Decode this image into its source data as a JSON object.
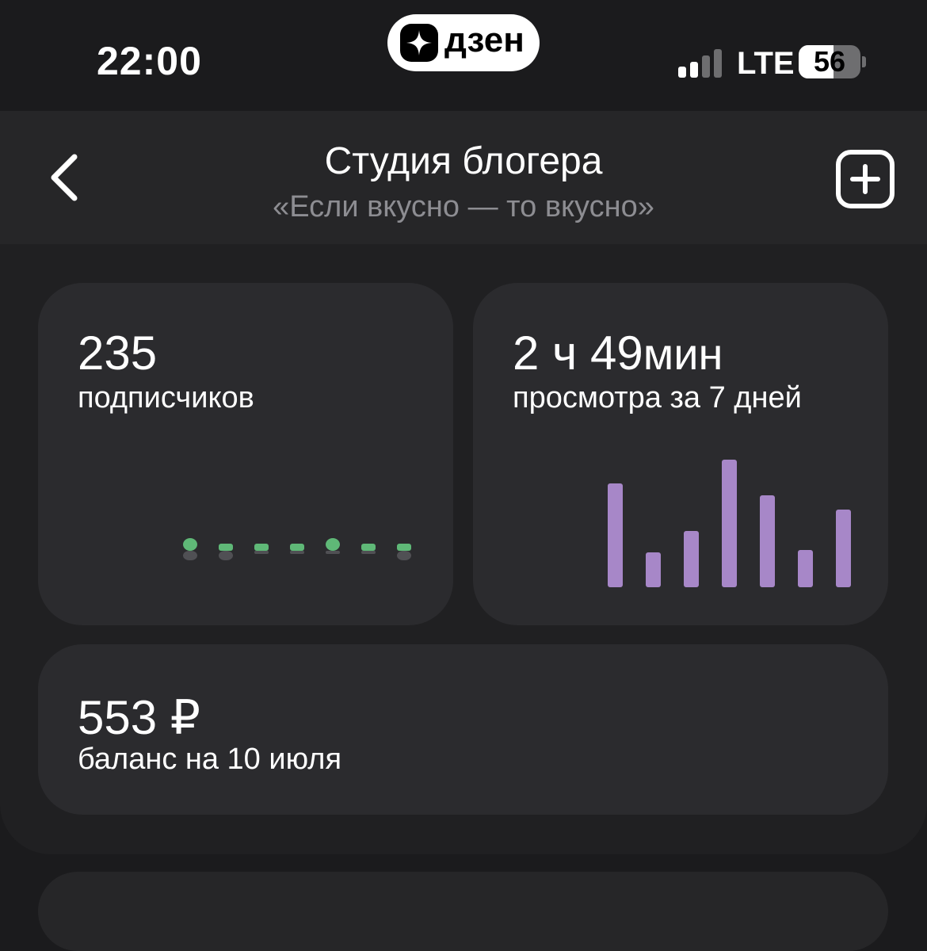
{
  "status_bar": {
    "time": "22:00",
    "app_badge": "дзен",
    "network": "LTE",
    "battery": "56",
    "battery_level": 0.56
  },
  "header": {
    "title": "Студия блогера",
    "subtitle": "«Если вкусно — то вкусно»"
  },
  "cards": {
    "subscribers": {
      "value": "235",
      "label": "подписчиков",
      "bars": [
        {
          "up": 1,
          "down": 1
        },
        {
          "up": 0.6,
          "down": 1
        },
        {
          "up": 0.6,
          "down": 0
        },
        {
          "up": 0.6,
          "down": 0
        },
        {
          "up": 1,
          "down": 0.3
        },
        {
          "up": 0.6,
          "down": 0
        },
        {
          "up": 0.6,
          "down": 1
        }
      ],
      "up_color": "#5fb877",
      "down_color": "#505054"
    },
    "views": {
      "value_hours": "2 ч",
      "value_minutes": "49",
      "value_unit": "мин",
      "label": "просмотра за 7 дней",
      "bars": [
        131,
        44,
        71,
        161,
        116,
        47,
        98
      ],
      "bar_color": "#a787c8"
    },
    "balance": {
      "value": "553 ₽",
      "label": "баланс на 10 июля"
    }
  }
}
